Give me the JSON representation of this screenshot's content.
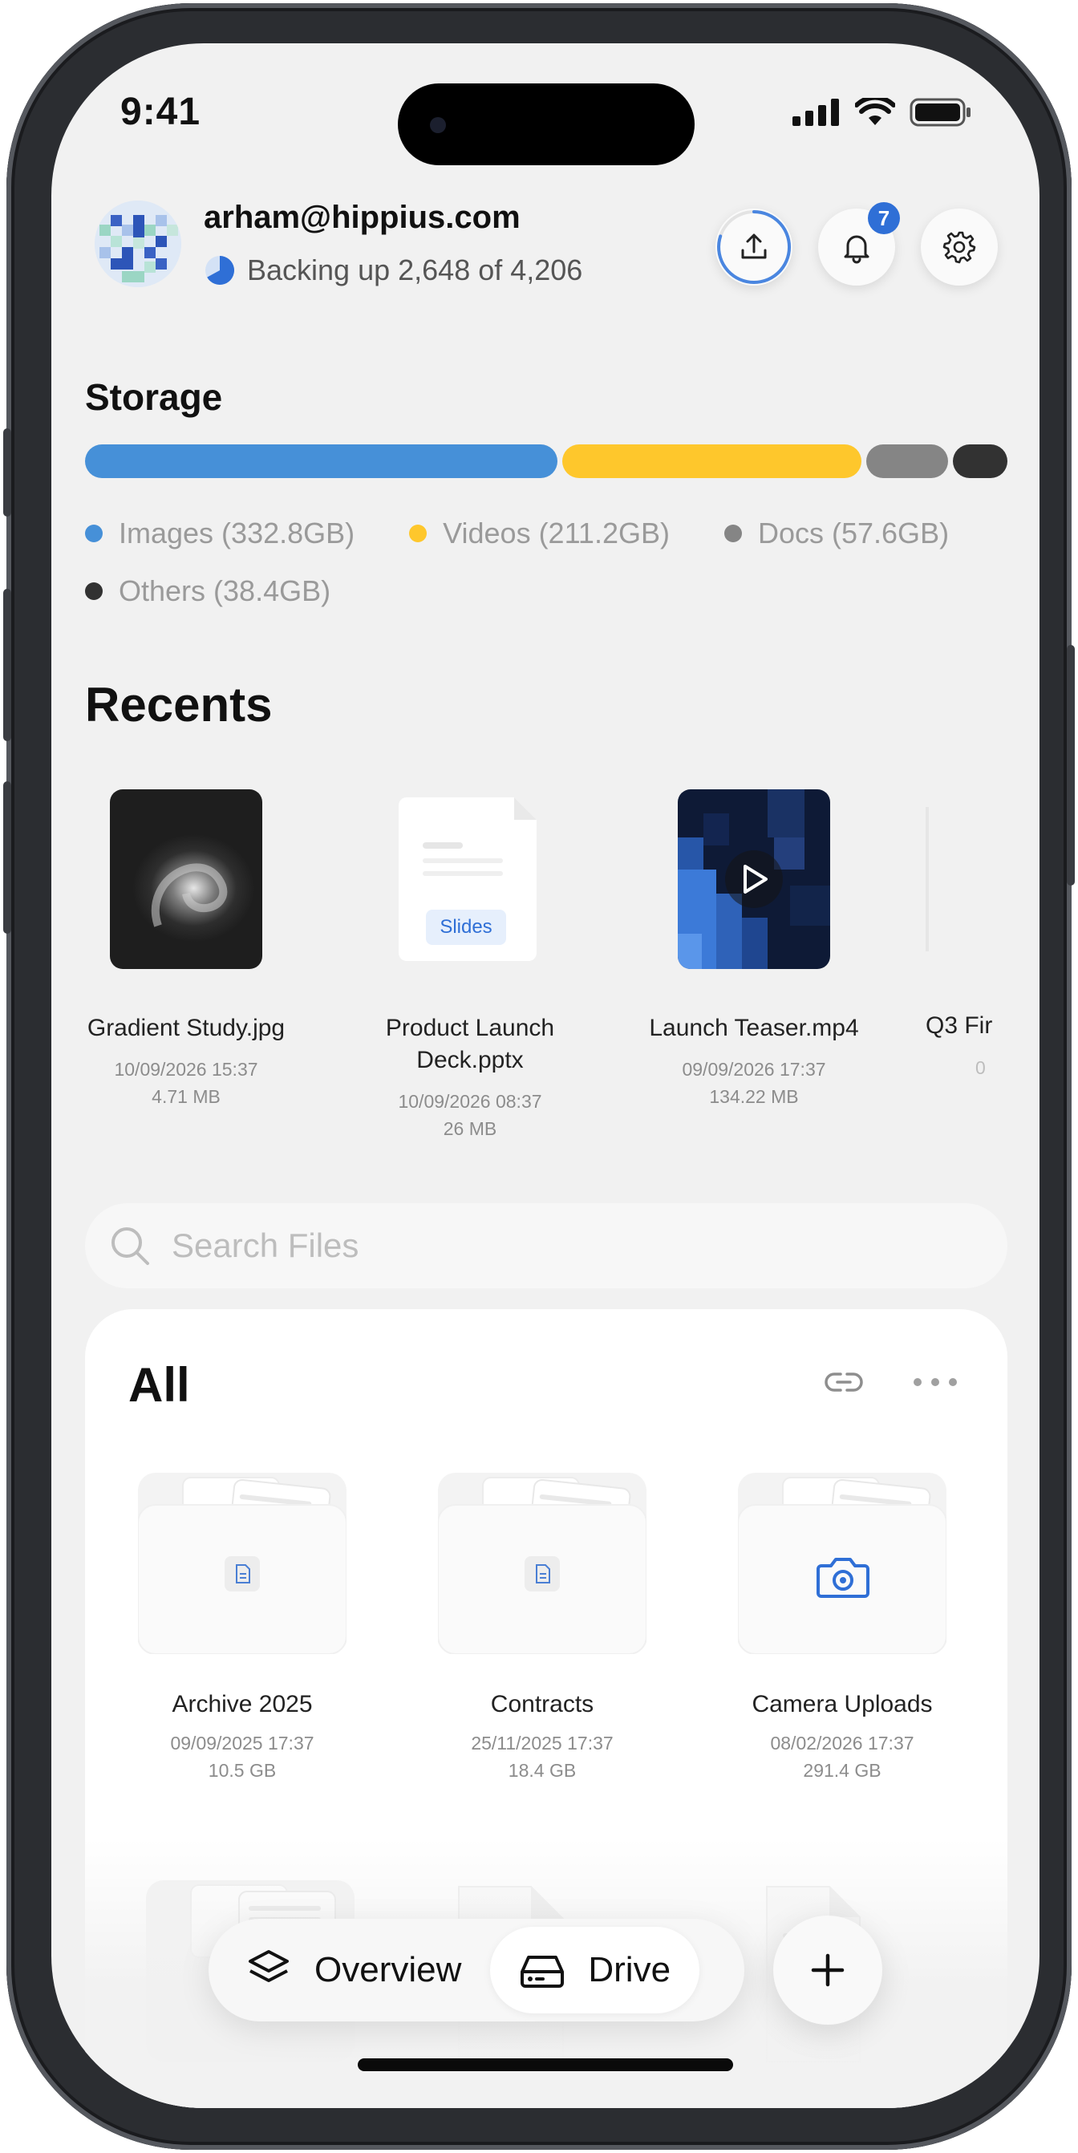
{
  "status_bar": {
    "time": "9:41"
  },
  "header": {
    "email": "arham@hippius.com",
    "backup_status": "Backing up 2,648 of 4,206",
    "backup_progress": 0.63,
    "notification_count": "7"
  },
  "storage": {
    "title": "Storage",
    "categories": [
      {
        "label": "Images (332.8GB)",
        "value_gb": 332.8,
        "color": "#4690d8"
      },
      {
        "label": "Videos (211.2GB)",
        "value_gb": 211.2,
        "color": "#fec72c"
      },
      {
        "label": "Docs (57.6GB)",
        "value_gb": 57.6,
        "color": "#858585"
      },
      {
        "label": "Others (38.4GB)",
        "value_gb": 38.4,
        "color": "#323232"
      }
    ]
  },
  "recents": {
    "title": "Recents",
    "items": [
      {
        "name": "Gradient Study.jpg",
        "date": "10/09/2026 15:37",
        "size": "4.71 MB"
      },
      {
        "name": "Product Launch Deck.pptx",
        "date": "10/09/2026 08:37",
        "size": "26 MB",
        "tag": "Slides"
      },
      {
        "name": "Launch Teaser.mp4",
        "date": "09/09/2026 17:37",
        "size": "134.22 MB"
      },
      {
        "name": "Q3 Fir",
        "date": "0",
        "size": ""
      }
    ]
  },
  "search": {
    "placeholder": "Search Files"
  },
  "all_files": {
    "title": "All",
    "folders": [
      {
        "name": "Archive 2025",
        "date": "09/09/2025 17:37",
        "size": "10.5 GB",
        "icon": "document-icon"
      },
      {
        "name": "Contracts",
        "date": "25/11/2025 17:37",
        "size": "18.4 GB",
        "icon": "document-icon"
      },
      {
        "name": "Camera Uploads",
        "date": "08/02/2026 17:37",
        "size": "291.4 GB",
        "icon": "camera-icon"
      }
    ]
  },
  "nav": {
    "tabs": [
      {
        "label": "Overview",
        "icon": "layers-icon",
        "active": false
      },
      {
        "label": "Drive",
        "icon": "drive-icon",
        "active": true
      }
    ]
  },
  "colors": {
    "accent": "#2f6fd6",
    "background": "#f1f1f1"
  }
}
